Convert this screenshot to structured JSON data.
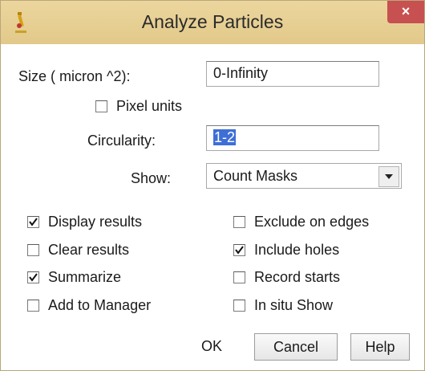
{
  "window": {
    "title": "Analyze Particles",
    "close_glyph": "×",
    "icon": "microscope-icon"
  },
  "size": {
    "label": "Size ( micron ^2):",
    "value": "0-Infinity"
  },
  "pixel_units": {
    "label": "Pixel units",
    "checked": false
  },
  "circularity": {
    "label": "Circularity:",
    "value": "1-2"
  },
  "show": {
    "label": "Show:",
    "selected": "Count Masks"
  },
  "options": {
    "display_results": {
      "label": "Display results",
      "checked": true
    },
    "clear_results": {
      "label": "Clear results",
      "checked": false
    },
    "summarize": {
      "label": "Summarize",
      "checked": true
    },
    "add_to_manager": {
      "label": "Add to Manager",
      "checked": false
    },
    "exclude_on_edges": {
      "label": "Exclude on edges",
      "checked": false
    },
    "include_holes": {
      "label": "Include holes",
      "checked": true
    },
    "record_starts": {
      "label": "Record starts",
      "checked": false
    },
    "in_situ_show": {
      "label": "In situ Show",
      "checked": false
    }
  },
  "buttons": {
    "ok": "OK",
    "cancel": "Cancel",
    "help": "Help"
  },
  "colors": {
    "titlebar": "#e2c98a",
    "close": "#c75050",
    "selection": "#3d6fd6"
  }
}
